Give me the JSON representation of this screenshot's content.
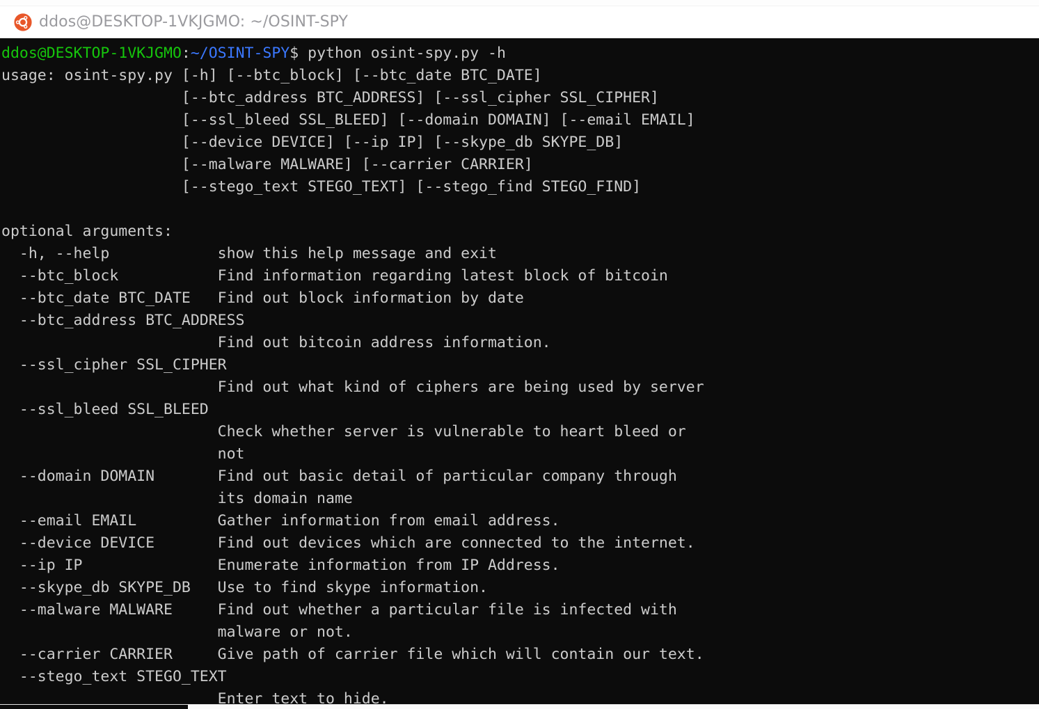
{
  "window": {
    "title": "ddos@DESKTOP-1VKJGMO: ~/OSINT-SPY",
    "icon": "ubuntu-logo-icon",
    "background_color": "#0c0c0c",
    "titlebar_color": "#ffffff",
    "titlebar_text_color": "#9a9a9e"
  },
  "colors": {
    "prompt_user": "#16c60c",
    "prompt_path": "#3b78ff",
    "foreground": "#cccccc",
    "background": "#0c0c0c"
  },
  "prompt": {
    "user_host": "ddos@DESKTOP-1VKJGMO",
    "separator": ":",
    "path": "~/OSINT-SPY",
    "sigil": "$",
    "command": " python osint-spy.py -h"
  },
  "output": {
    "usage_lines": [
      "usage: osint-spy.py [-h] [--btc_block] [--btc_date BTC_DATE]",
      "                    [--btc_address BTC_ADDRESS] [--ssl_cipher SSL_CIPHER]",
      "                    [--ssl_bleed SSL_BLEED] [--domain DOMAIN] [--email EMAIL]",
      "                    [--device DEVICE] [--ip IP] [--skype_db SKYPE_DB]",
      "                    [--malware MALWARE] [--carrier CARRIER]",
      "                    [--stego_text STEGO_TEXT] [--stego_find STEGO_FIND]"
    ],
    "blank_line": "",
    "section_header": "optional arguments:",
    "argument_lines": [
      "  -h, --help            show this help message and exit",
      "  --btc_block           Find information regarding latest block of bitcoin",
      "  --btc_date BTC_DATE   Find out block information by date",
      "  --btc_address BTC_ADDRESS",
      "                        Find out bitcoin address information.",
      "  --ssl_cipher SSL_CIPHER",
      "                        Find out what kind of ciphers are being used by server",
      "  --ssl_bleed SSL_BLEED",
      "                        Check whether server is vulnerable to heart bleed or",
      "                        not",
      "  --domain DOMAIN       Find out basic detail of particular company through",
      "                        its domain name",
      "  --email EMAIL         Gather information from email address.",
      "  --device DEVICE       Find out devices which are connected to the internet.",
      "  --ip IP               Enumerate information from IP Address.",
      "  --skype_db SKYPE_DB   Use to find skype information.",
      "  --malware MALWARE     Find out whether a particular file is infected with",
      "                        malware or not.",
      "  --carrier CARRIER     Give path of carrier file which will contain our text.",
      "  --stego_text STEGO_TEXT",
      "                        Enter text to hide."
    ]
  }
}
